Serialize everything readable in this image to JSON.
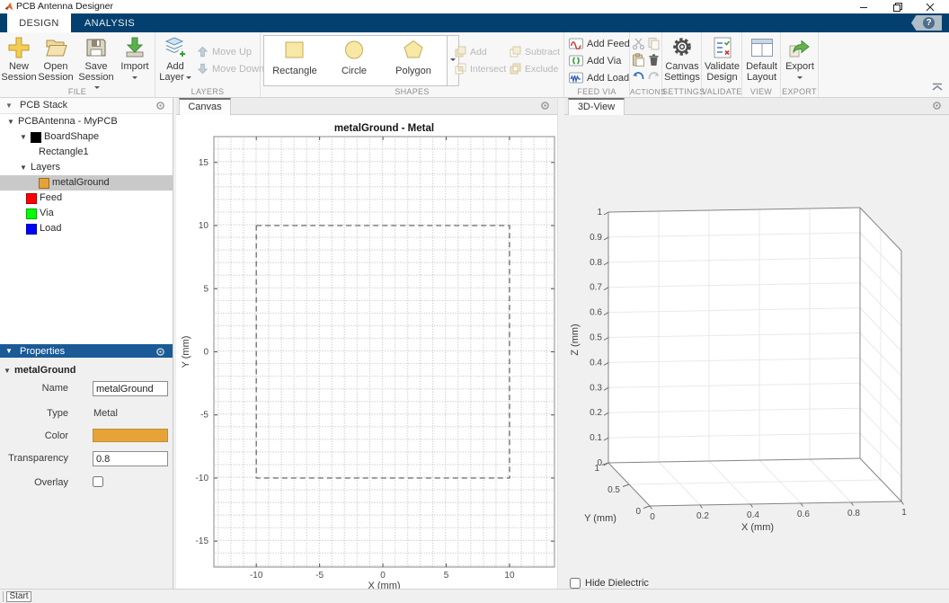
{
  "window": {
    "title": "PCB Antenna Designer"
  },
  "tab_bar": {
    "tabs": [
      {
        "label": "DESIGN",
        "active": true
      },
      {
        "label": "ANALYSIS",
        "active": false
      }
    ]
  },
  "ribbon": {
    "file": {
      "label": "FILE",
      "new_session": "New Session",
      "open_session": "Open Session",
      "save_session": "Save Session",
      "import": "Import"
    },
    "layers": {
      "label": "LAYERS",
      "add_layer": "Add Layer",
      "move_up": "Move Up",
      "move_down": "Move Down"
    },
    "shapes": {
      "label": "SHAPES",
      "rectangle": "Rectangle",
      "circle": "Circle",
      "polygon": "Polygon",
      "add": "Add",
      "subtract": "Subtract",
      "intersect": "Intersect",
      "exclude": "Exclude"
    },
    "feed_via": {
      "label": "FEED VIA",
      "add_feed": "Add Feed",
      "add_via": "Add Via",
      "add_load": "Add Load"
    },
    "actions": {
      "label": "ACTIONS"
    },
    "settings": {
      "label": "SETTINGS",
      "canvas_settings": "Canvas Settings"
    },
    "validate": {
      "label": "VALIDATE",
      "validate_design": "Validate Design"
    },
    "view": {
      "label": "VIEW",
      "default_layout": "Default Layout"
    },
    "export": {
      "label": "EXPORT",
      "export": "Export"
    }
  },
  "pcb_stack": {
    "title": "PCB Stack",
    "items": [
      {
        "label": "PCBAntenna - MyPCB",
        "indent": 8,
        "arrow": true
      },
      {
        "label": "BoardShape",
        "indent": 22,
        "arrow": true,
        "swatch": "#000000"
      },
      {
        "label": "Rectangle1",
        "indent": 43
      },
      {
        "label": "Layers",
        "indent": 22,
        "arrow": true
      },
      {
        "label": "metalGround",
        "indent": 43,
        "swatch": "#E7A33A",
        "selected": true
      },
      {
        "label": "Feed",
        "indent": 29,
        "swatch": "#FF0000"
      },
      {
        "label": "Via",
        "indent": 29,
        "swatch": "#00FF00"
      },
      {
        "label": "Load",
        "indent": 29,
        "swatch": "#0000FF"
      }
    ]
  },
  "properties": {
    "title": "Properties",
    "group": "metalGround",
    "fields": {
      "name": {
        "label": "Name",
        "value": "metalGround"
      },
      "type": {
        "label": "Type",
        "value": "Metal"
      },
      "color": {
        "label": "Color",
        "value": "#E7A33A"
      },
      "transparency": {
        "label": "Transparency",
        "value": "0.8"
      },
      "overlay": {
        "label": "Overlay",
        "checked": false
      }
    }
  },
  "canvas_panel": {
    "tab": "Canvas"
  },
  "view3d_panel": {
    "tab": "3D-View",
    "hide_dielectric": "Hide Dielectric"
  },
  "status_bar": {
    "start": "Start"
  },
  "chart_data": [
    {
      "id": "canvas2d",
      "type": "line",
      "title": "metalGround - Metal",
      "xlabel": "X (mm)",
      "ylabel": "Y (mm)",
      "xlim": [
        -13.35,
        13.55
      ],
      "ylim": [
        -17.05,
        17.05
      ],
      "xticks": [
        "-10",
        "-5",
        "0",
        "5",
        "10"
      ],
      "yticks": [
        "15",
        "10",
        "5",
        "0",
        "-5",
        "-10",
        "-15"
      ],
      "grid": "dotted-minor",
      "series": [
        {
          "name": "metalGround boundary",
          "style": "dashed",
          "x": [
            -10,
            10,
            10,
            -10,
            -10
          ],
          "y": [
            10,
            10,
            -10,
            -10,
            10
          ]
        }
      ]
    },
    {
      "id": "view3d",
      "type": "line",
      "subtype": "3d-box",
      "xlabel": "X (mm)",
      "ylabel": "Y (mm)",
      "zlabel": "Z (mm)",
      "xlim": [
        0,
        1
      ],
      "ylim": [
        0,
        1
      ],
      "zlim": [
        0,
        1
      ],
      "xticks": [
        "0",
        "0.2",
        "0.4",
        "0.6",
        "0.8",
        "1"
      ],
      "yticks": [
        "0",
        "0.5",
        "1"
      ],
      "zticks": [
        "0",
        "0.1",
        "0.2",
        "0.3",
        "0.4",
        "0.5",
        "0.6",
        "0.7",
        "0.8",
        "0.9",
        "1"
      ]
    }
  ]
}
